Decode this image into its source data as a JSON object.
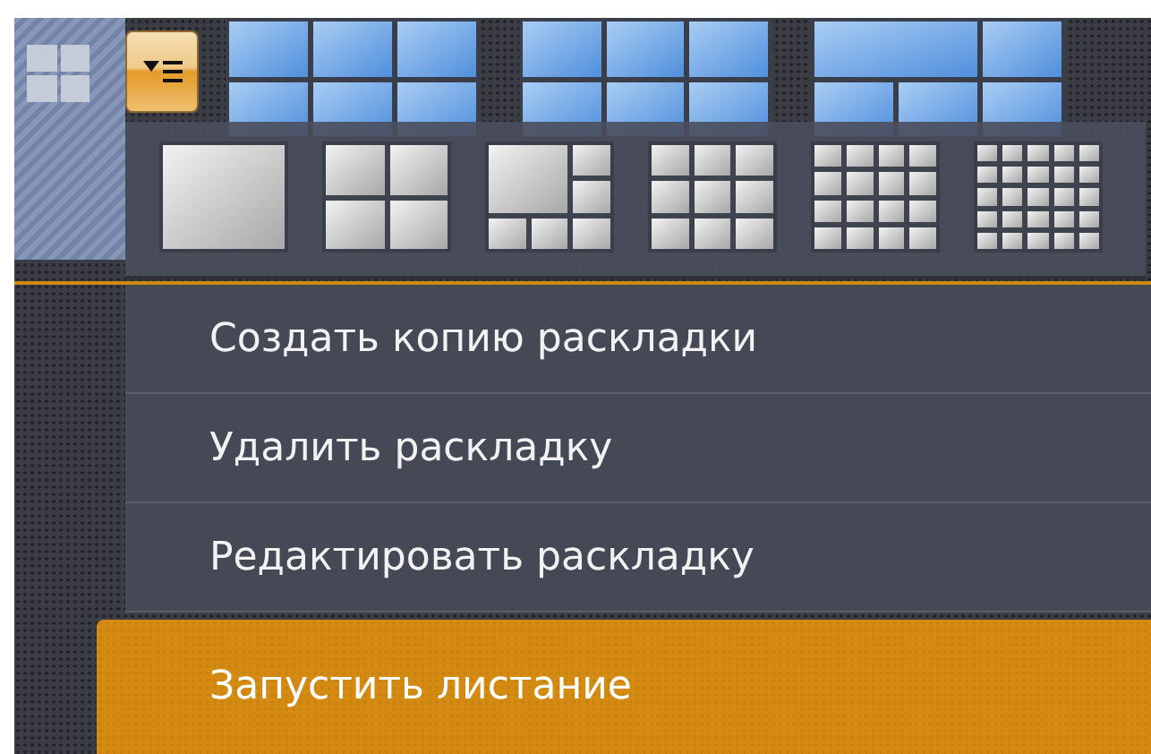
{
  "layout_thumbnails": [
    {
      "kind": "six"
    },
    {
      "kind": "six"
    },
    {
      "kind": "five"
    }
  ],
  "layout_picker": [
    {
      "kind": "single"
    },
    {
      "kind": "quad"
    },
    {
      "kind": "featured"
    },
    {
      "kind": "nine"
    },
    {
      "kind": "sixteen"
    },
    {
      "kind": "twentyfive"
    }
  ],
  "menu": [
    {
      "label": "Создать копию раскладки",
      "selected": false
    },
    {
      "label": "Удалить раскладку",
      "selected": false
    },
    {
      "label": "Редактировать раскладку",
      "selected": false
    },
    {
      "label": "Запустить листание",
      "selected": true
    }
  ]
}
